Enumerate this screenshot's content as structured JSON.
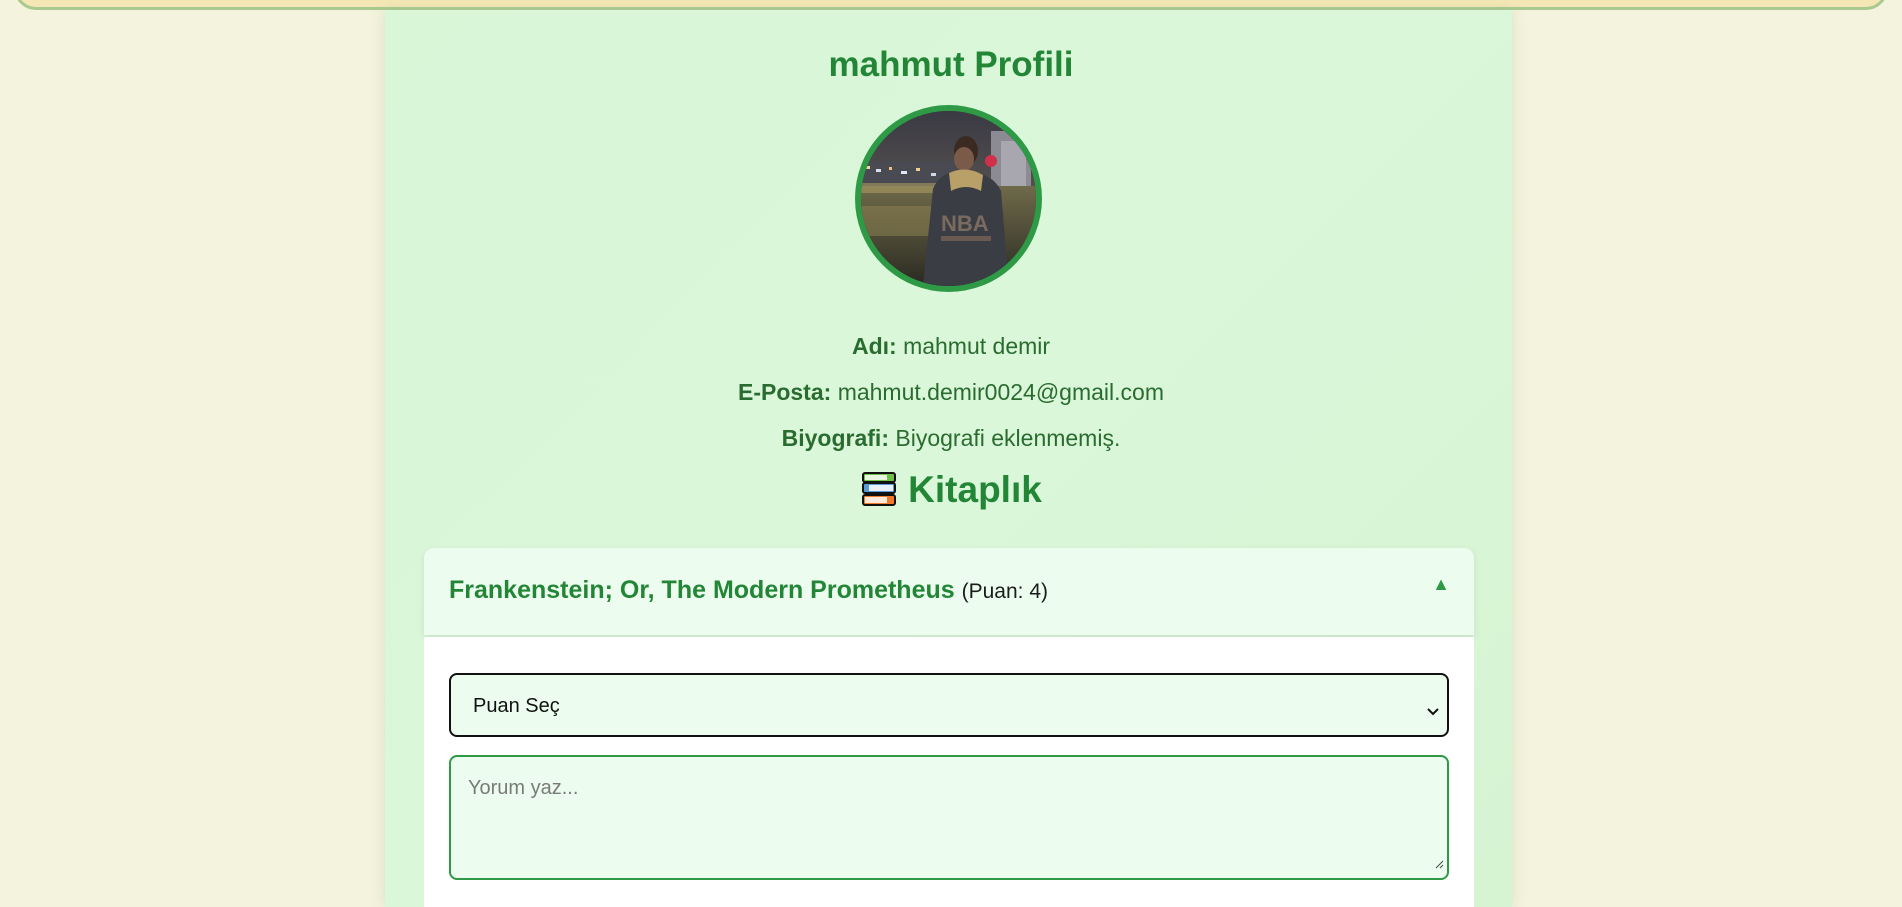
{
  "profile": {
    "title": "mahmut Profili",
    "name_label": "Adı:",
    "name_value": "mahmut demir",
    "email_label": "E-Posta:",
    "email_value": "mahmut.demir0024@gmail.com",
    "bio_label": "Biyografi:",
    "bio_value": "Biyografi eklenmemiş."
  },
  "library": {
    "icon": "books-icon",
    "title": "Kitaplık",
    "books": [
      {
        "title": "Frankenstein; Or, The Modern Prometheus",
        "score_text": "(Puan: 4)",
        "toggle_glyph": "▲",
        "rating_select_value": "Puan Seç",
        "comment_placeholder": "Yorum yaz..."
      }
    ]
  },
  "colors": {
    "page_bg": "#f4f3dd",
    "card_bg": "#d9f6d7",
    "accent": "#238636",
    "text_green": "#2a6c30",
    "avatar_border": "#2e9a46"
  }
}
